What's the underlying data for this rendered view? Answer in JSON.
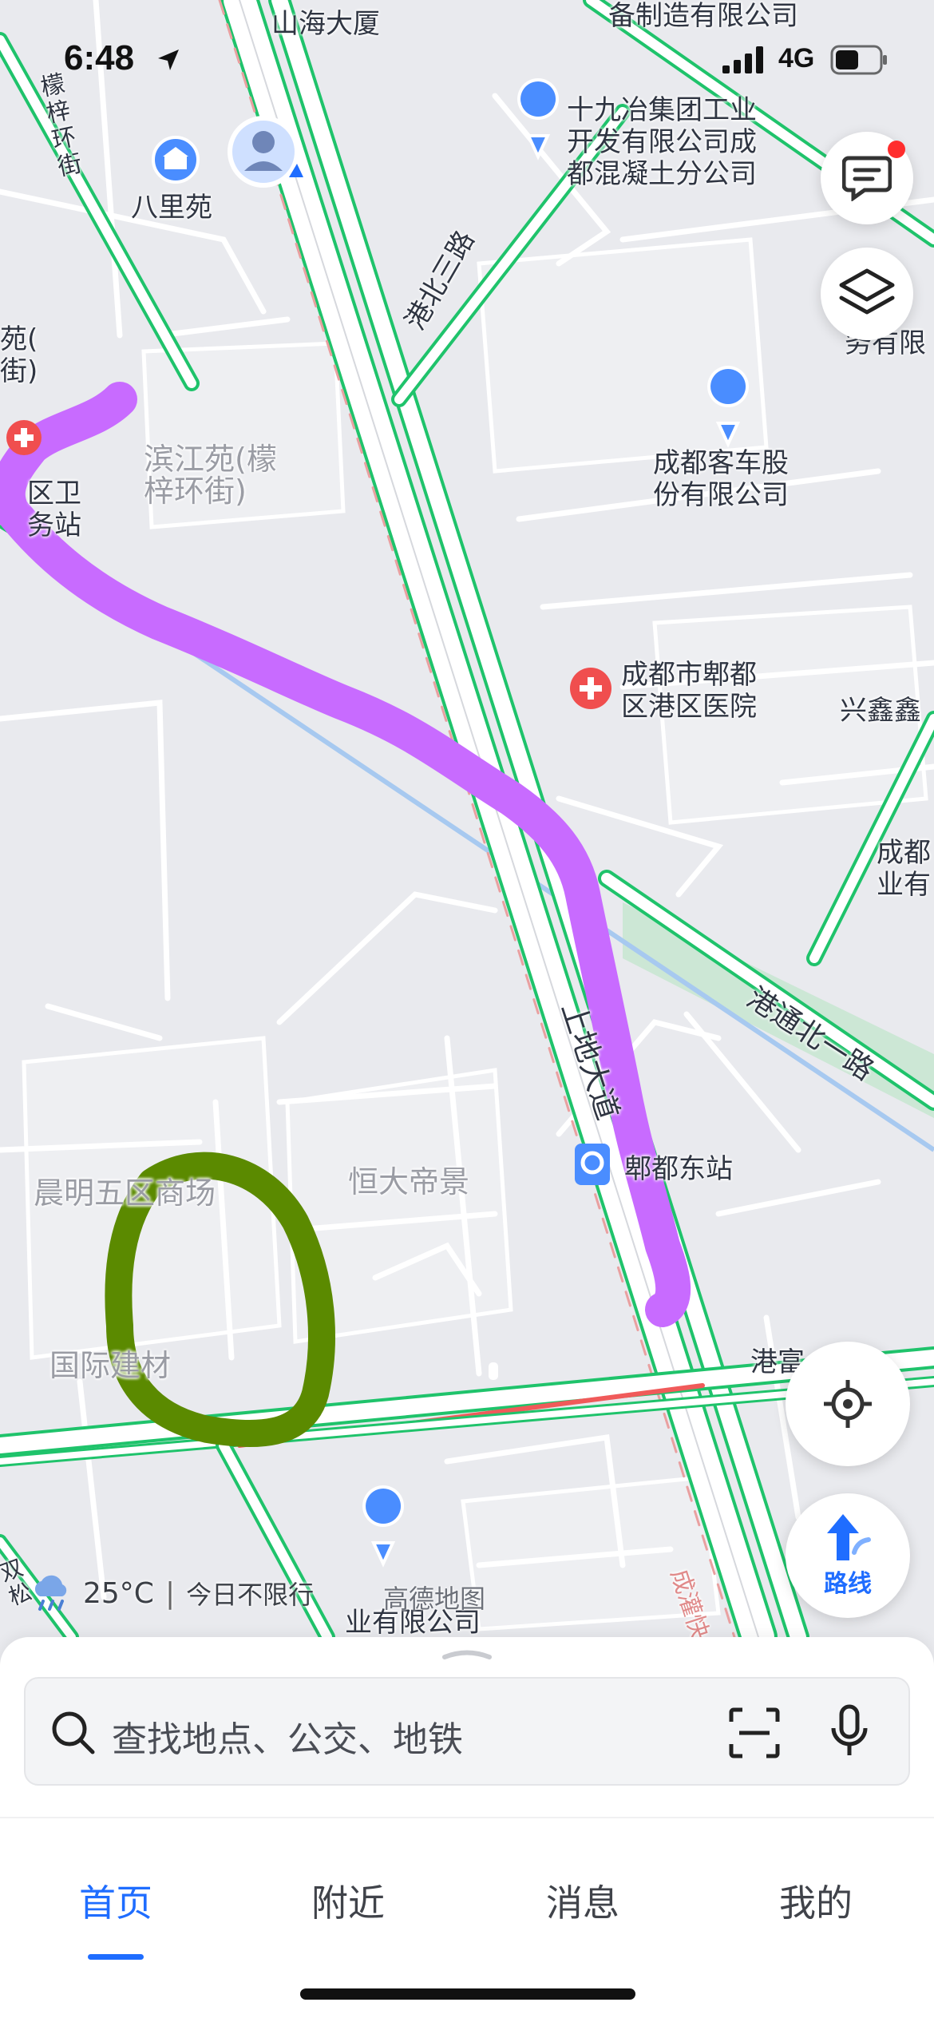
{
  "status_bar": {
    "time": "6:48",
    "network": "4G"
  },
  "map": {
    "labels": {
      "shanhai": "山海大厦",
      "beizhi": "备制造有限公司",
      "shijiu": "十九冶集团工业\n开发有限公司成\n都混凝土分公司",
      "lizhi_street": "檬\n梓\n环\n街",
      "balin": "八里苑",
      "gangbei_san": "港北三路",
      "yuan_left": "苑(\n街)",
      "jun_right": "君\n务有限",
      "binjiang": "滨江苑(檬\n梓环街)",
      "qu_wei": "区卫\n务站",
      "keche": "成都客车股\n份有限公司",
      "yiyuan": "成都市郫都\n区港区医院",
      "xinxin": "兴鑫鑫",
      "chengdu_right": "成都\n业有",
      "gangtong": "港通北一路",
      "shangda": "上地大道",
      "hengda": "恒大帝景",
      "chenming": "晨明五区商场",
      "dongzhan": "郫都东站",
      "guoji": "国际建材",
      "gangfu": "港富",
      "chengguan": "成灌快",
      "yeyou": "业有限公司",
      "bottom_left": "双\n松"
    }
  },
  "weather": {
    "temp": "25°C",
    "separator": "|",
    "restriction": "今日不限行",
    "watermark": "高德地图"
  },
  "controls": {
    "route_label": "路线"
  },
  "search": {
    "placeholder": "查找地点、公交、地铁"
  },
  "tabs": [
    {
      "label": "首页",
      "active": true
    },
    {
      "label": "附近"
    },
    {
      "label": "消息"
    },
    {
      "label": "我的"
    }
  ],
  "colors": {
    "accent": "#1f6dff",
    "road_outline": "#1fc36b",
    "purple_stroke": "#c86bff",
    "green_stroke": "#5b8a00",
    "hospital_red": "#f04e4e",
    "poi_blue": "#4a8dff"
  }
}
